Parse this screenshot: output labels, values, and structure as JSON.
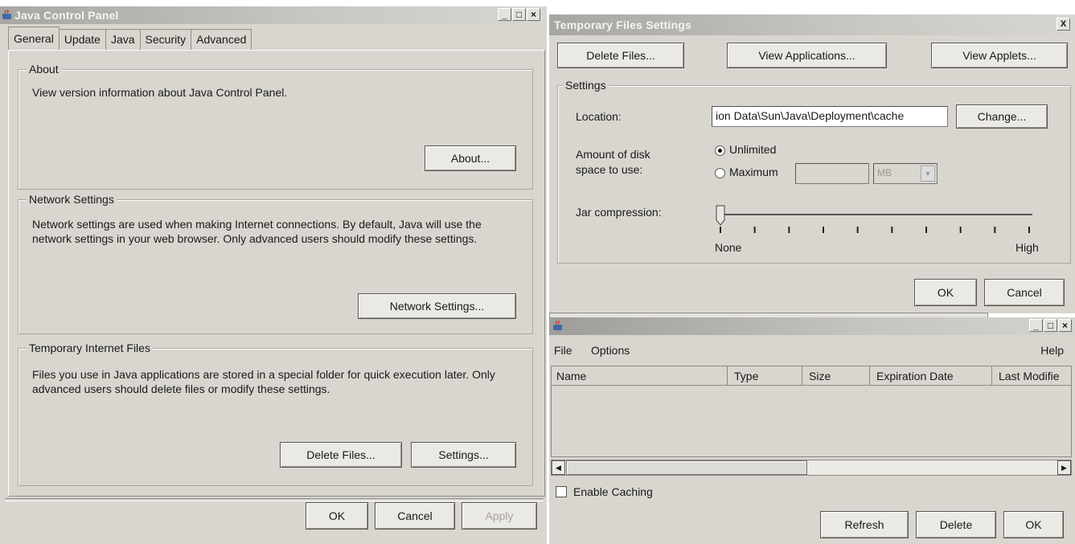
{
  "control_panel": {
    "title": "Java Control Panel",
    "tabs": [
      {
        "label": "General"
      },
      {
        "label": "Update"
      },
      {
        "label": "Java"
      },
      {
        "label": "Security"
      },
      {
        "label": "Advanced"
      }
    ],
    "about": {
      "legend": "About",
      "text": "View version information about Java Control Panel.",
      "button": "About..."
    },
    "network": {
      "legend": "Network Settings",
      "text": "Network settings are used when making Internet connections.  By default, Java will use the network settings in your web browser.  Only advanced users should modify these settings.",
      "button": "Network Settings..."
    },
    "temp_files": {
      "legend": "Temporary Internet Files",
      "text": "Files you use in Java applications are stored in a special folder for quick execution later.  Only advanced users should delete files or modify these settings.",
      "delete_button": "Delete Files...",
      "settings_button": "Settings..."
    },
    "footer": {
      "ok": "OK",
      "cancel": "Cancel",
      "apply": "Apply"
    }
  },
  "temp_settings": {
    "title": "Temporary Files Settings",
    "close": "X",
    "delete_files": "Delete Files...",
    "view_applications": "View Applications...",
    "view_applets": "View Applets...",
    "settings_legend": "Settings",
    "location_label": "Location:",
    "location_value": "ion Data\\Sun\\Java\\Deployment\\cache",
    "change_button": "Change...",
    "disk_label_1": "Amount of disk",
    "disk_label_2": "space to use:",
    "unlimited": "Unlimited",
    "maximum": "Maximum",
    "unit": "MB",
    "jar_label": "Jar compression:",
    "slider_min": "None",
    "slider_max": "High",
    "slider_value": 0,
    "ok": "OK",
    "cancel": "Cancel"
  },
  "applet_cache": {
    "menu": [
      "File",
      "Options"
    ],
    "help": "Help",
    "columns": [
      "Name",
      "Type",
      "Size",
      "Expiration Date",
      "Last Modifie"
    ],
    "enable_caching": "Enable Caching",
    "refresh": "Refresh",
    "delete": "Delete",
    "ok": "OK"
  }
}
